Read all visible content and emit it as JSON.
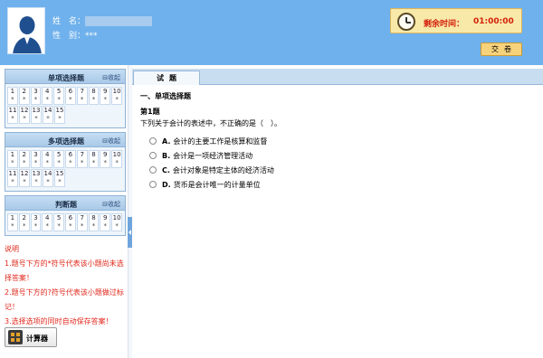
{
  "header": {
    "name_label": "姓　名：",
    "gender_label": "性　别：",
    "gender_value": "***",
    "timer_label": "剩余时间：",
    "timer_value": "01:00:00",
    "submit_label": "交卷"
  },
  "sidebar": {
    "collapse_label": "⊟收起",
    "sections": [
      {
        "title": "单项选择题",
        "rows": [
          [
            "1",
            "2",
            "3",
            "4",
            "5",
            "6",
            "7",
            "8",
            "9",
            "10"
          ],
          [
            "11",
            "12",
            "13",
            "14",
            "15"
          ]
        ]
      },
      {
        "title": "多项选择题",
        "rows": [
          [
            "1",
            "2",
            "3",
            "4",
            "5",
            "6",
            "7",
            "8",
            "9",
            "10"
          ],
          [
            "11",
            "12",
            "13",
            "14",
            "15"
          ]
        ]
      },
      {
        "title": "判断题",
        "rows": [
          [
            "1",
            "2",
            "3",
            "4",
            "5",
            "6",
            "7",
            "8",
            "9",
            "10"
          ]
        ]
      }
    ],
    "status_mark": "*",
    "note_title": "说明",
    "note_lines": [
      "1.题号下方的*符号代表该小题尚未选择答案！",
      "2.题号下方的?符号代表该小题做过标记！",
      "3.选择选项的同时自动保存答案！"
    ],
    "calculator_label": "计算器"
  },
  "main": {
    "tab_label": "试题",
    "section_title": "一、单项选择题",
    "question_no": "第1题",
    "question_text": "下列关于会计的表述中，不正确的是（　）。",
    "options": [
      {
        "letter": "A.",
        "text": "会计的主要工作是核算和监督"
      },
      {
        "letter": "B.",
        "text": "会计是一项经济管理活动"
      },
      {
        "letter": "C.",
        "text": "会计对象是特定主体的经济活动"
      },
      {
        "letter": "D.",
        "text": "货币是会计唯一的计量单位"
      }
    ]
  },
  "colors": {
    "header_bg": "#6fb1ec",
    "timer_text": "#d4210c",
    "note_text": "#e0271b"
  }
}
